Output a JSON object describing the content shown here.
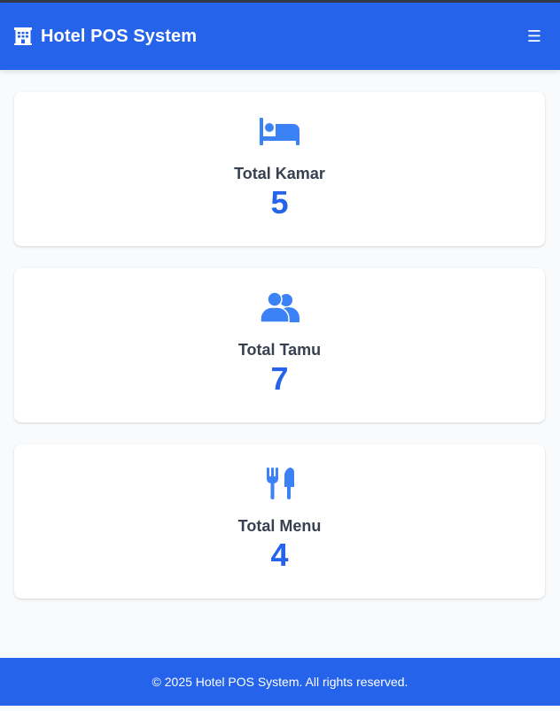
{
  "header": {
    "title": "Hotel POS System",
    "logo_icon": "hotel-building-icon",
    "menu_icon": "hamburger-menu-icon",
    "menu_glyph": "☰"
  },
  "stats": [
    {
      "icon": "bed-icon",
      "label": "Total Kamar",
      "value": "5"
    },
    {
      "icon": "users-icon",
      "label": "Total Tamu",
      "value": "7"
    },
    {
      "icon": "utensils-icon",
      "label": "Total Menu",
      "value": "4"
    }
  ],
  "footer": {
    "text": "© 2025 Hotel POS System. All rights reserved."
  },
  "colors": {
    "primary": "#2563eb",
    "icon": "#3b82f6",
    "label": "#374151",
    "background": "#f8fafc"
  }
}
